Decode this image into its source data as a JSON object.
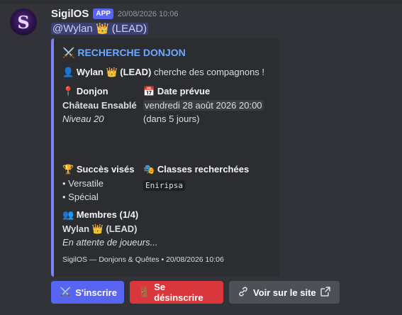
{
  "bot": {
    "name": "SigilOS",
    "tag": "APP",
    "timestamp": "20/08/2026 10:06",
    "avatar_letter": "S"
  },
  "mention": "@Wylan 👑 (LEAD)",
  "embed": {
    "accent": "#7c83f5",
    "title": "RECHERCHE DONJON",
    "desc_bold": "Wylan 👑 (LEAD)",
    "desc_rest": " cherche des compagnons !",
    "fields": {
      "dungeon": {
        "name": "Donjon",
        "value": "Château Ensablé",
        "sub": "Niveau 20"
      },
      "date": {
        "name": "Date prévue",
        "value": "vendredi 28 août 2026 20:00",
        "sub": "(dans 5 jours)"
      },
      "success": {
        "name": "Succès visés",
        "items": [
          "• Versatile",
          "• Spécial"
        ]
      },
      "classes": {
        "name": "Classes recherchées",
        "value": "Eniripsa"
      },
      "members": {
        "name": "Membres (1/4)",
        "leader": "Wylan 👑 (LEAD)",
        "waiting": "En attente de joueurs..."
      }
    },
    "footer": "SigilOS — Donjons & Quêtes • 20/08/2026 10:06"
  },
  "buttons": {
    "join": "S'inscrire",
    "leave": "Se désinscrire",
    "site": "Voir sur le site"
  }
}
